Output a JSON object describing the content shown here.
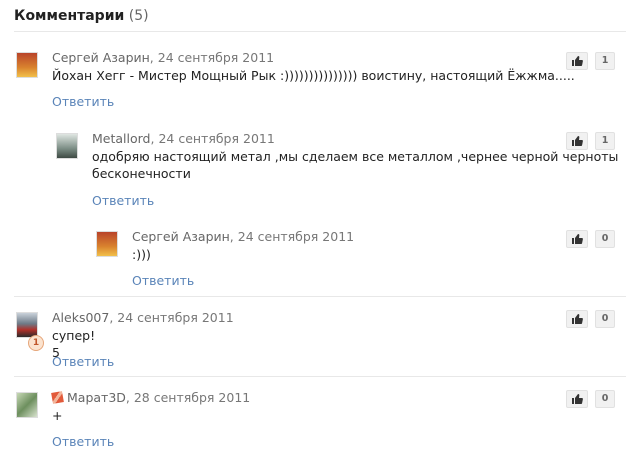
{
  "header": {
    "title": "Комментарии",
    "count": "(5)"
  },
  "reply_label": "Ответить",
  "comments": [
    {
      "author": "Сергей Азарин",
      "date": "24 сентября 2011",
      "text": "Йохан Хегг - Мистер Мощный Рык :))))))))))))))) воистину, настоящий Ёжжма.....",
      "likes": "1",
      "avatar": "avatar-orange"
    },
    {
      "author": "Metallord",
      "date": "24 сентября 2011",
      "text_line1": "одобряю настоящий метал ,мы сделаем все металлом ,чернее черной черноты",
      "text_line2": "бесконечности",
      "likes": "1",
      "avatar": "avatar-grey"
    },
    {
      "author": "Сергей Азарин",
      "date": "24 сентября 2011",
      "text": ":)))",
      "likes": "0",
      "avatar": "avatar-orange"
    },
    {
      "author": "Aleks007",
      "date": "24 сентября 2011",
      "text": "супер! 5",
      "likes": "0",
      "badge": "1",
      "avatar": "avatar-car"
    },
    {
      "author": "Марат3D",
      "date": "28 сентября 2011",
      "text": "+",
      "likes": "0",
      "avatar": "avatar-map",
      "medal_icon": "medal-icon"
    }
  ]
}
